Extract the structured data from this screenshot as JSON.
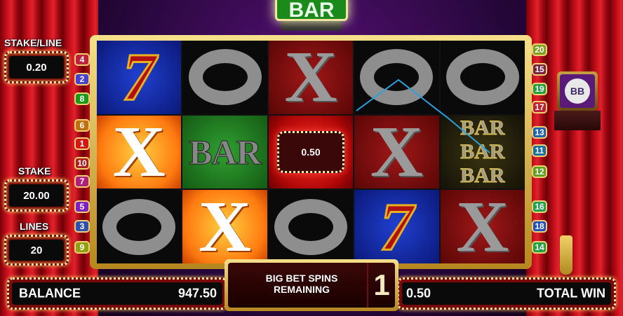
{
  "game": {
    "logo_text": "BAR",
    "stake_line_label": "STAKE/LINE",
    "stake_line_value": "0.20",
    "stake_label": "STAKE",
    "stake_value": "20.00",
    "lines_label": "LINES",
    "lines_value": "20",
    "balance_label": "BALANCE",
    "balance_value": "947.50",
    "total_win_label": "TOTAL WIN",
    "total_win_value": "0.50",
    "big_bet_line1": "BIG BET SPINS",
    "big_bet_line2": "REMAINING",
    "big_bet_count": "1",
    "big_bet_button": "BB",
    "win_amount": "0.50"
  },
  "left_badges": [
    {
      "n": "4",
      "color": "#c0203a"
    },
    {
      "n": "2",
      "color": "#4a40d0"
    },
    {
      "n": "8",
      "color": "#1a9a1a"
    },
    {
      "n": "6",
      "color": "#c07010"
    },
    {
      "n": "1",
      "color": "#d01818"
    },
    {
      "n": "10",
      "color": "#b02020"
    },
    {
      "n": "7",
      "color": "#b0207a"
    },
    {
      "n": "5",
      "color": "#8020c0"
    },
    {
      "n": "3",
      "color": "#3050b0"
    },
    {
      "n": "9",
      "color": "#90a010"
    }
  ],
  "right_badges": [
    {
      "n": "20",
      "color": "#80a020"
    },
    {
      "n": "15",
      "color": "#7a2040"
    },
    {
      "n": "19",
      "color": "#20a040"
    },
    {
      "n": "17",
      "color": "#c02030"
    },
    {
      "n": "13",
      "color": "#2060b0"
    },
    {
      "n": "11",
      "color": "#1a70a0"
    },
    {
      "n": "12",
      "color": "#60a020"
    },
    {
      "n": "16",
      "color": "#20a050"
    },
    {
      "n": "18",
      "color": "#2050c0"
    },
    {
      "n": "14",
      "color": "#20a040"
    }
  ],
  "reels": [
    [
      "7",
      "X",
      "O"
    ],
    [
      "O",
      "BAR",
      "X"
    ],
    [
      "X",
      "WIN",
      "O"
    ],
    [
      "O",
      "X",
      "7"
    ],
    [
      "O",
      "3BAR",
      "X"
    ]
  ],
  "bar_text": "BAR"
}
